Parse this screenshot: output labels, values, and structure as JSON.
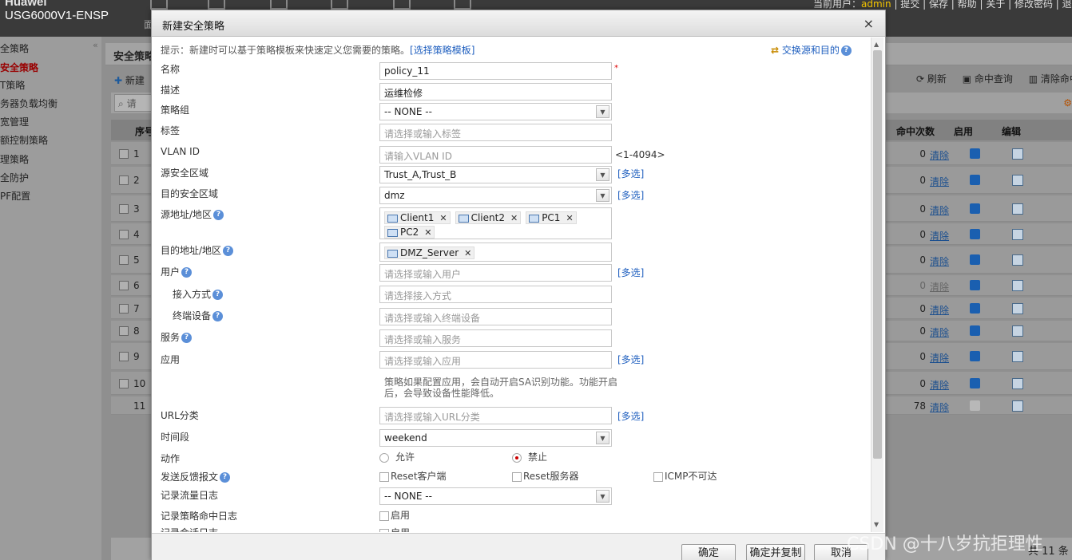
{
  "topbar": {
    "brand_line1": "Huawei",
    "brand_line2": "USG6000V1-ENSP",
    "icon_label": "面",
    "links": "当前用户：",
    "user": "admin",
    "links_rest": " | 提交 | 保存 | 帮助 | 关于 | 修改密码 | 退出"
  },
  "leftnav": {
    "items": [
      "全策略",
      "安全策略",
      "T策略",
      "务器负载均衡",
      "宽管理",
      "额控制策略",
      "理策略",
      "全防护",
      "PF配置"
    ]
  },
  "bg": {
    "tab_title": "安全策略",
    "new_label": "新建",
    "search_placeholder": "请",
    "tools": [
      "刷新",
      "命中查询",
      "清除命中查"
    ],
    "headers": {
      "seq": "序号",
      "hits": "命中次数",
      "enable": "启用",
      "edit": "编辑"
    },
    "clear_label": "清除",
    "rows": [
      {
        "num": "1",
        "hits": "0",
        "enabled": true
      },
      {
        "num": "2",
        "hits": "0",
        "enabled": true
      },
      {
        "num": "3",
        "hits": "0",
        "enabled": true
      },
      {
        "num": "4",
        "hits": "0",
        "enabled": true
      },
      {
        "num": "5",
        "hits": "0",
        "enabled": true
      },
      {
        "num": "6",
        "hits": "0",
        "enabled": true,
        "disabled_row": true
      },
      {
        "num": "7",
        "hits": "0",
        "enabled": true
      },
      {
        "num": "8",
        "hits": "0",
        "enabled": true
      },
      {
        "num": "9",
        "hits": "0",
        "enabled": true
      },
      {
        "num": "10",
        "hits": "0",
        "enabled": true
      },
      {
        "num": "11",
        "hits": "78",
        "enabled": false
      }
    ],
    "total": "共 11 条",
    "watermark": "CSDN @十八岁抗拒理性"
  },
  "dialog": {
    "title": "新建安全策略",
    "close": "×",
    "tip_text": "提示：新建时可以基于策略模板来快速定义您需要的策略。",
    "tip_link": "[选择策略模板]",
    "swap_label": "交换源和目的",
    "fields": {
      "name_label": "名称",
      "name_value": "policy_11",
      "desc_label": "描述",
      "desc_value": "运维检修",
      "group_label": "策略组",
      "group_value": "-- NONE --",
      "tag_label": "标签",
      "tag_placeholder": "请选择或输入标签",
      "vlan_label": "VLAN ID",
      "vlan_placeholder": "请输入VLAN ID",
      "vlan_hint": "<1-4094>",
      "src_zone_label": "源安全区域",
      "src_zone_value": "Trust_A,Trust_B",
      "dst_zone_label": "目的安全区域",
      "dst_zone_value": "dmz",
      "src_addr_label": "源地址/地区",
      "src_addr_tags": [
        "Client1",
        "Client2",
        "PC1",
        "PC2"
      ],
      "dst_addr_label": "目的地址/地区",
      "dst_addr_tags": [
        "DMZ_Server"
      ],
      "user_label": "用户",
      "user_placeholder": "请选择或输入用户",
      "access_label": "接入方式",
      "access_placeholder": "请选择接入方式",
      "terminal_label": "终端设备",
      "terminal_placeholder": "请选择或输入终端设备",
      "service_label": "服务",
      "service_placeholder": "请选择或输入服务",
      "app_label": "应用",
      "app_placeholder": "请选择或输入应用",
      "app_note": "策略如果配置应用，会自动开启SA识别功能。功能开启后，会导致设备性能降低。",
      "url_label": "URL分类",
      "url_placeholder": "请选择或输入URL分类",
      "time_label": "时间段",
      "time_value": "weekend",
      "action_label": "动作",
      "action_allow": "允许",
      "action_deny": "禁止",
      "action_selected": "deny",
      "feedback_label": "发送反馈报文",
      "reset_client": "Reset客户端",
      "reset_server": "Reset服务器",
      "icmp": "ICMP不可达",
      "traffic_log_label": "记录流量日志",
      "traffic_log_value": "-- NONE --",
      "hit_log_label": "记录策略命中日志",
      "hit_log_enable": "启用",
      "session_log_label": "记录会话日志",
      "session_log_enable": "启用"
    },
    "multi_select": "[多选]",
    "buttons": {
      "ok": "确定",
      "ok_copy": "确定并复制",
      "cancel": "取消"
    }
  }
}
